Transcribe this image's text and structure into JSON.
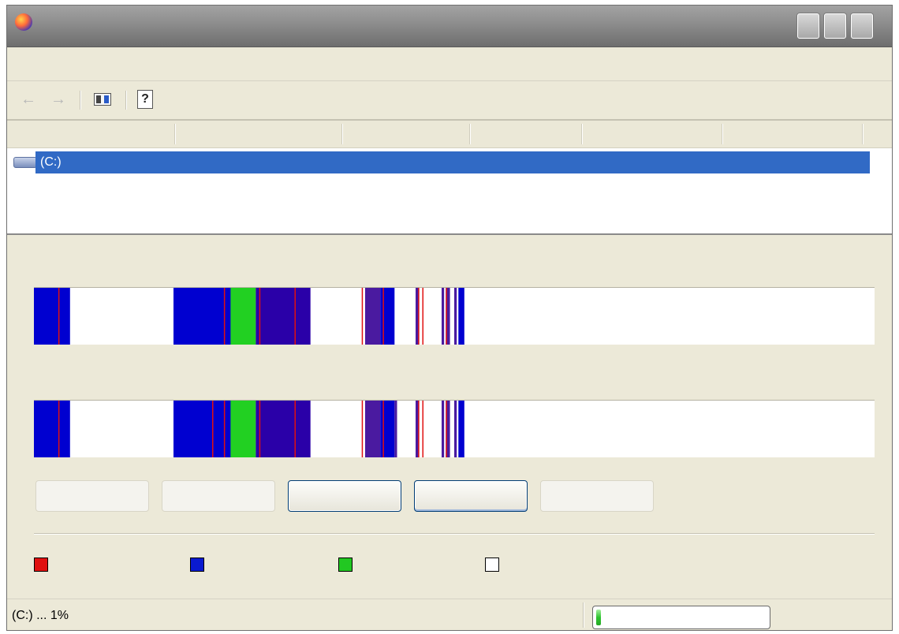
{
  "window": {
    "title": "",
    "icon": "app-icon"
  },
  "drives": [
    {
      "label": "(C:)",
      "selected": true
    }
  ],
  "columns": [
    "",
    "",
    "",
    "",
    "",
    ""
  ],
  "maps": {
    "before": {
      "segments": [
        {
          "start": 0,
          "end": 0.043,
          "color": "#0000d0"
        },
        {
          "start": 0.166,
          "end": 0.234,
          "color": "#0000d0"
        },
        {
          "start": 0.234,
          "end": 0.264,
          "color": "#22d022"
        },
        {
          "start": 0.264,
          "end": 0.329,
          "color": "#2a00a8"
        },
        {
          "start": 0.394,
          "end": 0.412,
          "color": "#4a1aa0"
        },
        {
          "start": 0.412,
          "end": 0.429,
          "color": "#0000d0"
        },
        {
          "start": 0.454,
          "end": 0.458,
          "color": "#4a1aa0"
        },
        {
          "start": 0.485,
          "end": 0.488,
          "color": "#4a1aa0"
        },
        {
          "start": 0.49,
          "end": 0.495,
          "color": "#4a1aa0"
        },
        {
          "start": 0.5,
          "end": 0.503,
          "color": "#4a1aa0"
        },
        {
          "start": 0.505,
          "end": 0.512,
          "color": "#0000d0"
        }
      ],
      "red_lines": [
        0.029,
        0.226,
        0.268,
        0.31,
        0.39,
        0.415,
        0.457,
        0.462,
        0.49
      ]
    },
    "after": {
      "segments": [
        {
          "start": 0,
          "end": 0.043,
          "color": "#0000d0"
        },
        {
          "start": 0.166,
          "end": 0.234,
          "color": "#0000d0"
        },
        {
          "start": 0.234,
          "end": 0.264,
          "color": "#22d022"
        },
        {
          "start": 0.264,
          "end": 0.329,
          "color": "#2a00a8"
        },
        {
          "start": 0.394,
          "end": 0.412,
          "color": "#4a1aa0"
        },
        {
          "start": 0.412,
          "end": 0.429,
          "color": "#0000d0"
        },
        {
          "start": 0.429,
          "end": 0.432,
          "color": "#4a1aa0"
        },
        {
          "start": 0.454,
          "end": 0.458,
          "color": "#4a1aa0"
        },
        {
          "start": 0.485,
          "end": 0.488,
          "color": "#4a1aa0"
        },
        {
          "start": 0.49,
          "end": 0.495,
          "color": "#4a1aa0"
        },
        {
          "start": 0.5,
          "end": 0.503,
          "color": "#4a1aa0"
        },
        {
          "start": 0.505,
          "end": 0.512,
          "color": "#0000d0"
        }
      ],
      "red_lines": [
        0.029,
        0.212,
        0.226,
        0.268,
        0.31,
        0.39,
        0.415,
        0.457,
        0.462,
        0.49
      ]
    }
  },
  "buttons": [
    {
      "label": "",
      "enabled": false
    },
    {
      "label": "",
      "enabled": false
    },
    {
      "label": "",
      "enabled": true
    },
    {
      "label": "",
      "enabled": true
    },
    {
      "label": "",
      "enabled": false
    }
  ],
  "legend": [
    {
      "label": "",
      "color": "#e01010"
    },
    {
      "label": "",
      "color": "#0a1ad0"
    },
    {
      "label": "",
      "color": "#22c822"
    },
    {
      "label": "",
      "color": "#ffffff"
    }
  ],
  "status": {
    "text": "(C:) ... 1%",
    "progress": 0.01
  }
}
